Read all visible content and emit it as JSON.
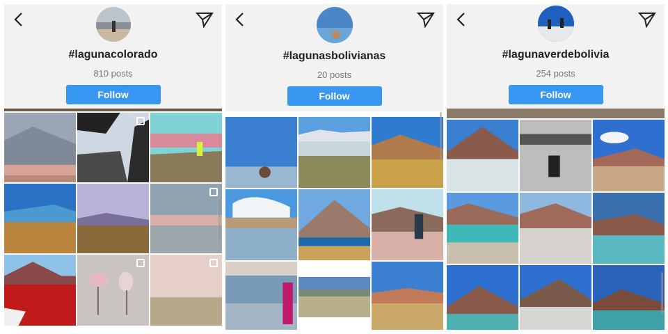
{
  "accent": "#3897f0",
  "panels": [
    {
      "hashtag": "#lagunacolorado",
      "posts": "810 posts",
      "follow_label": "Follow"
    },
    {
      "hashtag": "#lagunasbolivianas",
      "posts": "20 posts",
      "follow_label": "Follow"
    },
    {
      "hashtag": "#lagunaverdebolivia",
      "posts": "254 posts",
      "follow_label": "Follow"
    }
  ],
  "icons": {
    "back": "chevron-left-icon",
    "share": "paper-plane-icon",
    "multi": "carousel-icon"
  }
}
